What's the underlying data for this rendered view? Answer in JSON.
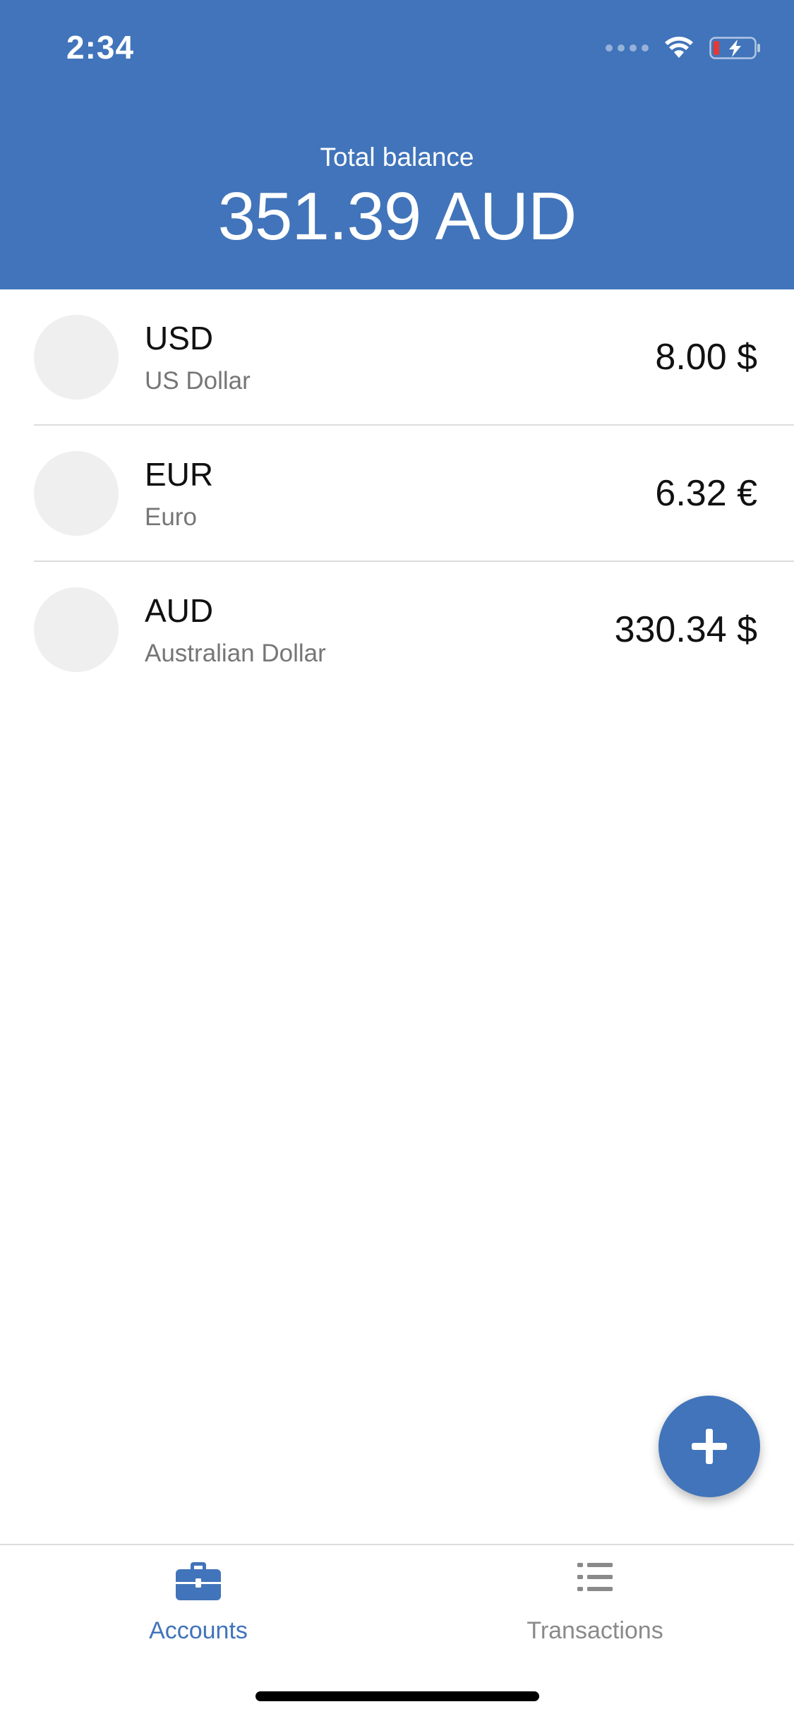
{
  "status_bar": {
    "time": "2:34"
  },
  "header": {
    "total_label": "Total balance",
    "total_amount": "351.39 AUD"
  },
  "accounts": [
    {
      "code": "USD",
      "name": "US Dollar",
      "balance": "8.00 $"
    },
    {
      "code": "EUR",
      "name": "Euro",
      "balance": "6.32 €"
    },
    {
      "code": "AUD",
      "name": "Australian Dollar",
      "balance": "330.34 $"
    }
  ],
  "tabs": [
    {
      "label": "Accounts",
      "icon": "briefcase-icon",
      "active": true
    },
    {
      "label": "Transactions",
      "icon": "list-icon",
      "active": false
    }
  ],
  "fab": {
    "icon": "plus-icon"
  },
  "colors": {
    "primary": "#4174ba",
    "divider": "#dcdcdc",
    "avatar_placeholder": "#efefef",
    "inactive_tab": "#8a8a8a"
  }
}
